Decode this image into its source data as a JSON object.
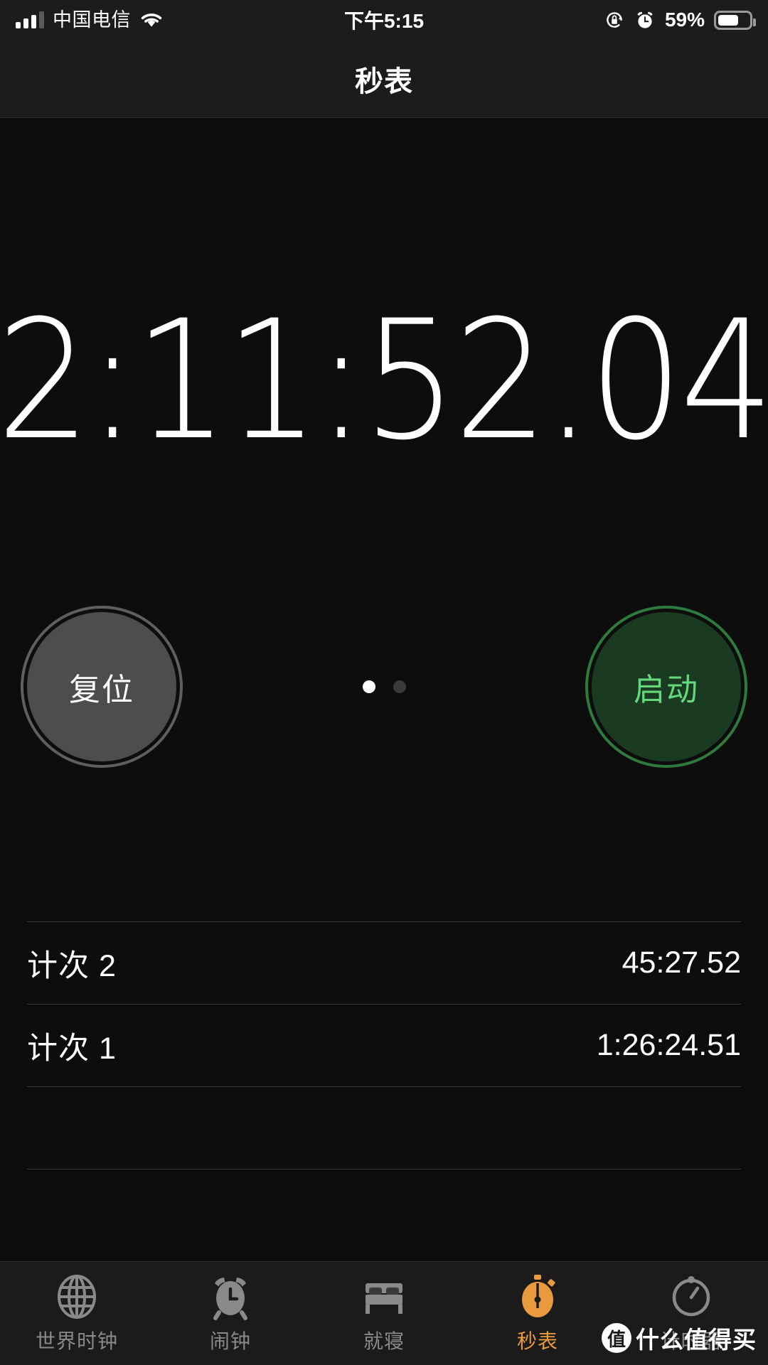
{
  "status_bar": {
    "carrier": "中国电信",
    "signal_icon": "signal-bars-icon",
    "wifi_icon": "wifi-icon",
    "time": "下午5:15",
    "rotation_lock_icon": "rotation-lock-icon",
    "alarm_icon": "alarm-clock-icon",
    "battery_percent": "59%",
    "battery_level": 59,
    "battery_icon": "battery-icon"
  },
  "navbar": {
    "title": "秒表"
  },
  "stopwatch": {
    "display_time": "2:11:52.04",
    "reset_button": "复位",
    "start_button": "启动",
    "page_dots": {
      "count": 2,
      "active_index": 0
    }
  },
  "laps": {
    "rows": [
      {
        "label": "计次 2",
        "time": "45:27.52"
      },
      {
        "label": "计次 1",
        "time": "1:26:24.51"
      },
      {
        "label": "",
        "time": ""
      },
      {
        "label": "",
        "time": ""
      }
    ]
  },
  "tabbar": {
    "tabs": [
      {
        "label": "世界时钟",
        "icon": "globe-icon",
        "active": false
      },
      {
        "label": "闹钟",
        "icon": "alarm-clock-icon",
        "active": false
      },
      {
        "label": "就寝",
        "icon": "bed-icon",
        "active": false
      },
      {
        "label": "秒表",
        "icon": "stopwatch-icon",
        "active": true
      },
      {
        "label": "计时器",
        "icon": "timer-icon",
        "active": false
      }
    ]
  },
  "watermark": {
    "badge": "值",
    "text": "什么值得买"
  },
  "colors": {
    "background": "#0d0d0d",
    "bar_background": "#1c1c1c",
    "accent_orange": "#ea9a3e",
    "start_green_text": "#64d97c",
    "start_green_fill": "#1b3a22",
    "reset_gray_fill": "#4d4d4d",
    "separator": "#3a3a3a",
    "inactive_tab": "#8a8a8a"
  }
}
